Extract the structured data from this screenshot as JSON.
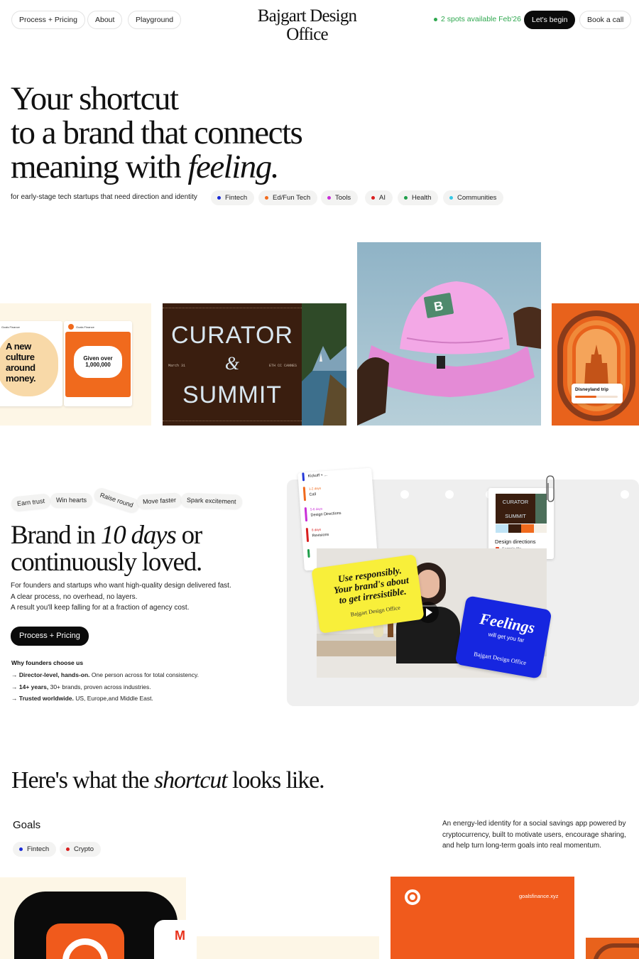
{
  "nav": {
    "links": [
      "Process + Pricing",
      "About",
      "Playground"
    ],
    "logo_line1": "Bajgart Design",
    "logo_line2": "Office",
    "availability": "2 spots available Feb'26",
    "cta_primary": "Let's begin",
    "cta_secondary": "Book a call"
  },
  "hero": {
    "line1": "Your shortcut",
    "line2": "to a brand that connects",
    "line3_pre": "meaning with ",
    "line3_em": "feeling.",
    "subtitle": "for early-stage tech startups that need direction and identity",
    "tags": [
      {
        "label": "Fintech",
        "color": "#1a2bd6"
      },
      {
        "label": "Ed/Fun Tech",
        "color": "#f26b1d"
      },
      {
        "label": "Tools",
        "color": "#c92fd8"
      },
      {
        "label": "AI",
        "color": "#d91f1f"
      },
      {
        "label": "Health",
        "color": "#1f9e4a"
      },
      {
        "label": "Communities",
        "color": "#38c9e6"
      }
    ]
  },
  "gallery": {
    "goals_card1_brand": "Goals Finance",
    "goals_card1_text": "A new culture around money.",
    "goals_card2_brand": "Goals Finance",
    "goals_card2_text": "Given over 1,000,000",
    "curator_title1": "CURATOR",
    "curator_amp": "&",
    "curator_title2": "SUMMIT",
    "curator_date": "March 31",
    "curator_place": "ETH CC CANNES",
    "disney_label": "Disneyland trip"
  },
  "offer": {
    "benefits": [
      "Earn trust",
      "Win hearts",
      "Raise round",
      "Move faster",
      "Spark excitement"
    ],
    "title_pre": "Brand in ",
    "title_em": "10 days",
    "title_post": " or",
    "title_line2": "continuously loved.",
    "desc": [
      "For founders and startups who want high-quality design delivered fast.",
      "A clear process, no overhead, no layers.",
      "A result you'll keep falling for at a fraction of agency cost."
    ],
    "cta": "Process + Pricing",
    "why_title": "Why founders choose us",
    "reasons": [
      {
        "bold": "Director-level, hands-on.",
        "rest": " One person across for total consistency."
      },
      {
        "bold": "14+ years,",
        "rest": " 30+ brands, proven across industries."
      },
      {
        "bold": "Trusted worldwide.",
        "rest": " US, Europe,and Middle East."
      }
    ]
  },
  "collage": {
    "steps": [
      {
        "days": "",
        "label": "Kickoff + ..."
      },
      {
        "days": "1-2 days",
        "label": "Call"
      },
      {
        "days": "5-6 days",
        "label": "Design Directions"
      },
      {
        "days": "8 days",
        "label": "Revisions"
      }
    ],
    "yellow_line1": "Use responsibly.",
    "yellow_line2": "Your brand's about",
    "yellow_line3": "to get irresistible.",
    "yellow_sign": "Bajgart Design Office",
    "blue_big": "Feelings",
    "blue_small": "will get you far",
    "blue_sign": "Bajgart Design Office",
    "card_title1": "CURATOR",
    "card_title2": "SUMMIT",
    "card_caption": "Design directions",
    "card_sub": "Sample file"
  },
  "showcase": {
    "title_pre": "Here's what the ",
    "title_em": "shortcut",
    "title_post": " looks like.",
    "project": "Goals",
    "tags": [
      {
        "label": "Fintech",
        "color": "#1a2bd6"
      },
      {
        "label": "Crypto",
        "color": "#d91f1f"
      }
    ],
    "description": "An energy-led identity for a social savings app powered by cryptocurrency, built to motivate users, encourage sharing, and help turn long-term goals into real momentum.",
    "site_url": "goalsfinance.xyz"
  }
}
